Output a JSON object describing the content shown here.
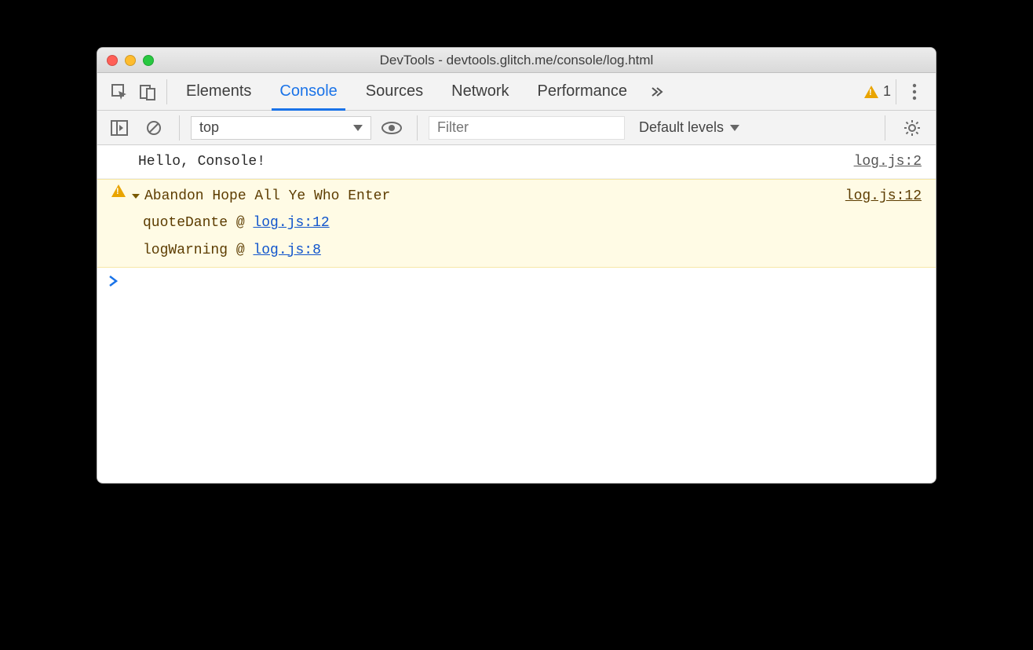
{
  "window": {
    "title": "DevTools - devtools.glitch.me/console/log.html"
  },
  "tabs": {
    "elements": "Elements",
    "console": "Console",
    "sources": "Sources",
    "network": "Network",
    "performance": "Performance"
  },
  "badges": {
    "warn_count": "1"
  },
  "toolbar": {
    "context": "top",
    "filter_placeholder": "Filter",
    "levels": "Default levels"
  },
  "console": {
    "log1": {
      "text": "Hello, Console!",
      "source": "log.js:2"
    },
    "warn1": {
      "text": "Abandon Hope All Ye Who Enter",
      "source": "log.js:12",
      "stack": [
        {
          "fn": "quoteDante",
          "at": "log.js:12"
        },
        {
          "fn": "logWarning",
          "at": "log.js:8"
        }
      ]
    }
  }
}
